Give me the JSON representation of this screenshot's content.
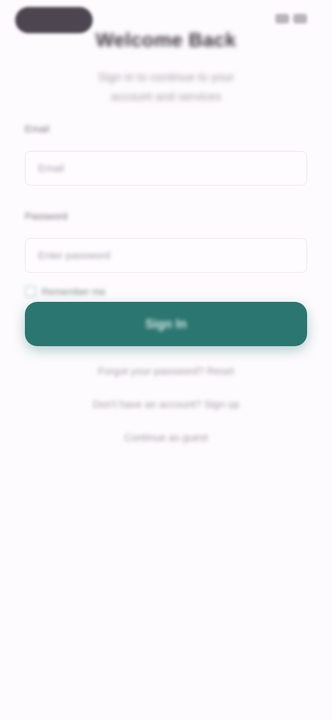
{
  "header": {
    "title": "Welcome Back",
    "subtitle_line1": "Sign in to continue to your",
    "subtitle_line2": "account and services"
  },
  "form": {
    "username": {
      "label": "Email",
      "placeholder": "Email"
    },
    "password": {
      "label": "Password",
      "placeholder": "Enter password"
    },
    "remember_label": "Remember me",
    "submit_label": "Sign In"
  },
  "links": {
    "forgot_password": "Forgot your password? Reset",
    "create_account": "Don't have an account? Sign up",
    "guest": "Continue as guest"
  },
  "colors": {
    "accent": "#2b7670",
    "background": "#fdfbfd"
  }
}
